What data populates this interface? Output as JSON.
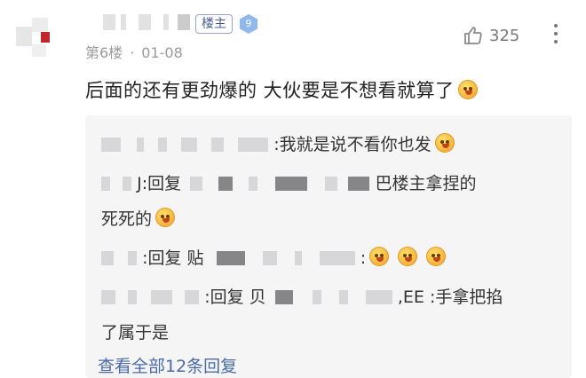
{
  "post": {
    "host_badge": "楼主",
    "level": "9",
    "floor": "第6楼",
    "date": "01-08",
    "likes": "325",
    "content": "后面的还有更劲爆的 大伙要是不想看就算了"
  },
  "replies": [
    {
      "text": ":我就是说不看你也发"
    },
    {
      "prefix": "J:回复",
      "suffix": "巴楼主拿捏的",
      "cont": "死死的"
    },
    {
      "prefix": ":回复 贴",
      "suffix": ":"
    },
    {
      "prefix": ":回复 贝",
      "suffix": ",EE :手拿把掐",
      "cont": "了属于是"
    }
  ],
  "view_all": "查看全部12条回复",
  "icons": [
    "thumbs-up-icon",
    "more-icon",
    "grin-emoji-icon"
  ],
  "colors": {
    "link": "#4a6aa8",
    "reply_bg": "#f5f5f6",
    "badge_border": "#9aa6c8"
  }
}
